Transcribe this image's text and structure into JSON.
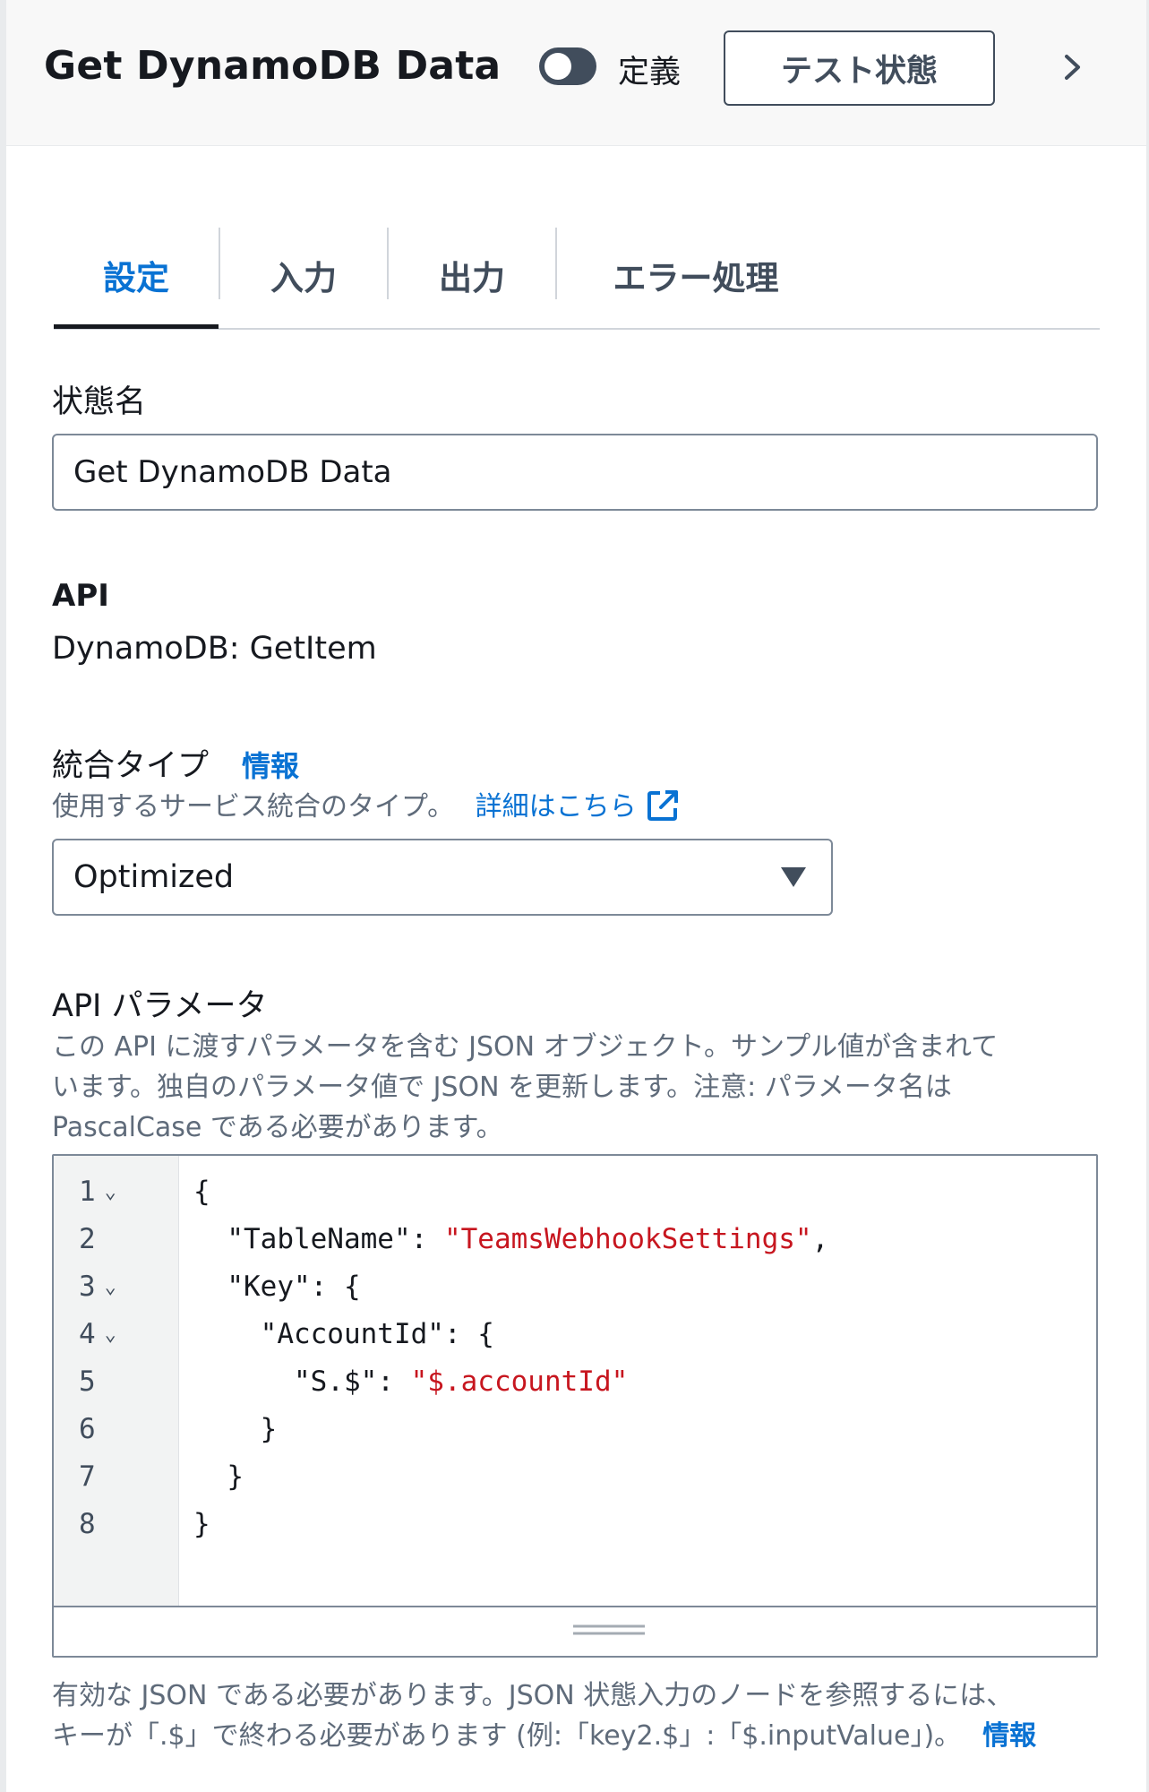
{
  "header": {
    "title": "Get DynamoDB Data",
    "toggle_label": "定義",
    "toggle_on": false,
    "test_button_label": "テスト状態",
    "next_icon": "chevron-right-icon"
  },
  "tabs": [
    {
      "label": "設定",
      "active": true
    },
    {
      "label": "入力",
      "active": false
    },
    {
      "label": "出力",
      "active": false
    },
    {
      "label": "エラー処理",
      "active": false
    }
  ],
  "state_name": {
    "label": "状態名",
    "value": "Get DynamoDB Data"
  },
  "api": {
    "label": "API",
    "value": "DynamoDB: GetItem"
  },
  "integration_type": {
    "label": "統合タイプ",
    "info_link": "情報",
    "description": "使用するサービス統合のタイプ。",
    "learn_more_link": "詳細はこちら",
    "selected": "Optimized"
  },
  "api_params": {
    "label": "API パラメータ",
    "description_lines": [
      "この API に渡すパラメータを含む JSON オブジェクト。サンプル値が含まれて",
      "います。独自のパラメータ値で JSON を更新します。注意: パラメータ名は",
      "PascalCase である必要があります。"
    ],
    "line_numbers": [
      "1",
      "2",
      "3",
      "4",
      "5",
      "6",
      "7",
      "8"
    ],
    "code": {
      "l1": "{",
      "l2_key": "  \"TableName\": ",
      "l2_val": "\"TeamsWebhookSettings\"",
      "l2_end": ",",
      "l3": "  \"Key\": {",
      "l4": "    \"AccountId\": {",
      "l5_key": "      \"S.$\": ",
      "l5_val": "\"$.accountId\"",
      "l6": "    }",
      "l7": "  }",
      "l8": "}"
    },
    "help_lines": [
      "有効な JSON である必要があります。JSON 状態入力のノードを参照するには、",
      "キーが「.$」で終わる必要があります (例:「key2.$」:「$.inputValue」)。"
    ],
    "help_info_link": "情報"
  },
  "colors": {
    "accent": "#0972d3",
    "string": "#c7161f",
    "text": "#16191f",
    "muted": "#5f6b7a"
  }
}
